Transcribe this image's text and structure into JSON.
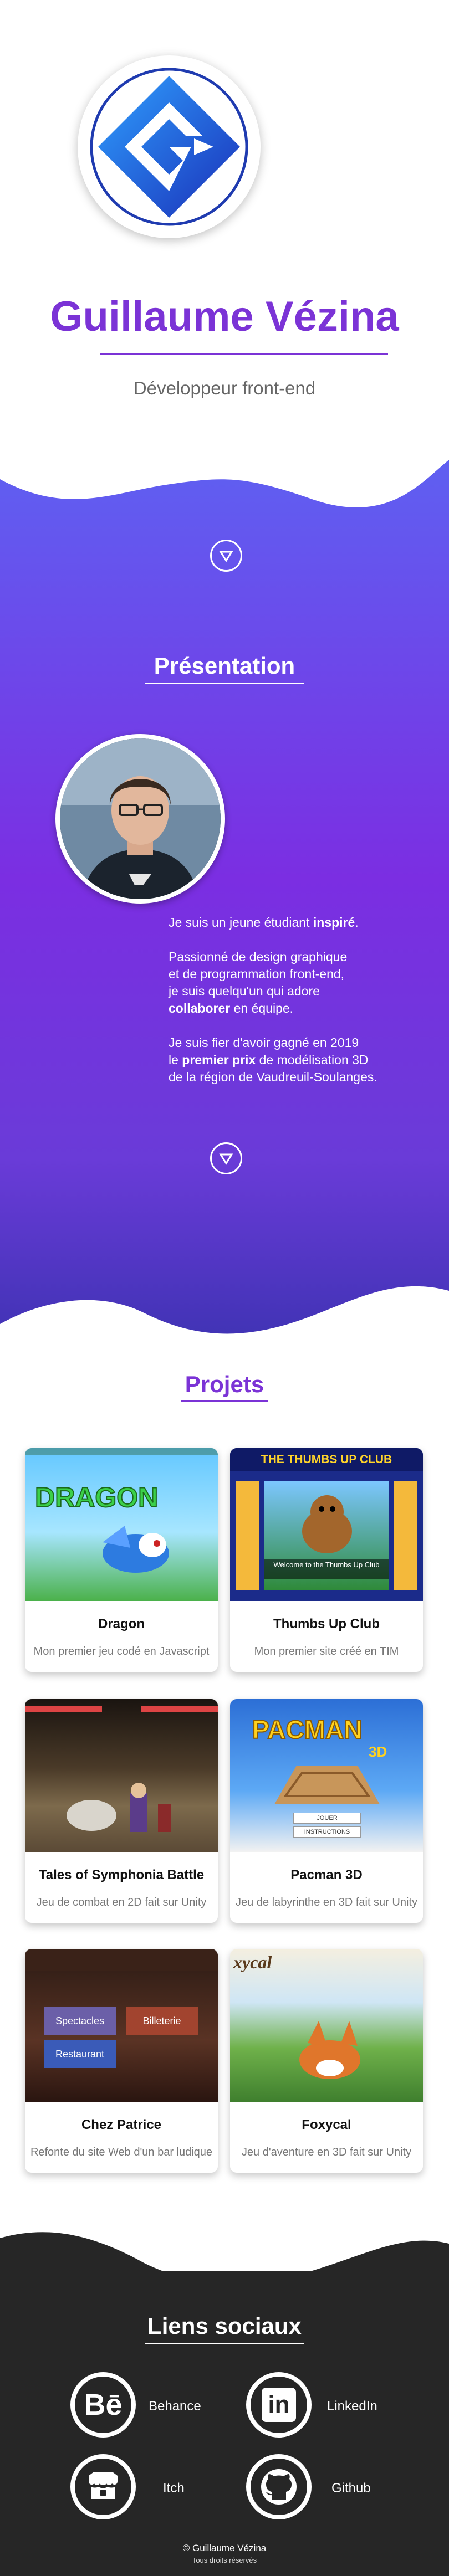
{
  "header": {
    "name": "Guillaume Vézina",
    "subtitle": "Développeur front-end"
  },
  "presentation": {
    "title": "Présentation",
    "p1_pre": "Je suis un jeune étudiant ",
    "p1_bold": "inspiré",
    "p1_post": ".",
    "p2_line1": "Passionné de design graphique",
    "p2_line2": "et de programmation front-end,",
    "p2_line3": "je suis quelqu'un qui adore",
    "p2_bold": "collaborer",
    "p2_post": " en équipe.",
    "p3_line1": "Je suis fier d'avoir gagné en 2019",
    "p3_pre": "le ",
    "p3_bold": "premier prix",
    "p3_post": " de modélisation 3D",
    "p3_line3": "de la région de Vaudreuil-Soulanges."
  },
  "projects": {
    "title": "Projets",
    "items": [
      {
        "title": "Dragon",
        "desc": "Mon premier jeu codé en Javascript"
      },
      {
        "title": "Thumbs Up Club",
        "desc": "Mon premier site créé en TIM"
      },
      {
        "title": "Tales of Symphonia Battle",
        "desc": "Jeu de combat en 2D fait sur Unity"
      },
      {
        "title": "Pacman 3D",
        "desc": "Jeu de labyrinthe en 3D fait sur Unity"
      },
      {
        "title": "Chez Patrice",
        "desc": "Refonte du site Web d'un bar ludique"
      },
      {
        "title": "Foxycal",
        "desc": "Jeu d'aventure en 3D fait sur Unity"
      }
    ],
    "thumb_text": {
      "dragon_logo": "DRAGON",
      "thumbs_header": "THE THUMBS UP CLUB",
      "thumbs_welcome": "Welcome to the Thumbs Up Club",
      "pacman_logo": "PACMAN",
      "pacman_3d": "3D",
      "pacman_btn1": "JOUER",
      "pacman_btn2": "INSTRUCTIONS",
      "patrice_btn1": "Spectacles",
      "patrice_btn2": "Billeterie",
      "patrice_btn3": "Restaurant",
      "foxycal_logo": "xycal"
    }
  },
  "social": {
    "title": "Liens sociaux",
    "behance_label": "Behance",
    "linkedin_label": "LinkedIn",
    "itch_label": "Itch",
    "github_label": "Github",
    "behance_glyph": "Bē",
    "linkedin_glyph": "in",
    "copyright": "© Guillaume Vézina",
    "rights": "Tous droits réservés"
  },
  "colors": {
    "accent": "#7b33d6",
    "gradient_top": "#5d63f2",
    "gradient_bottom": "#3b32b0",
    "footer": "#262626"
  },
  "icons": {
    "logo": "gv-logo-icon",
    "scroll": "chevron-down-circle-icon",
    "behance": "behance-icon",
    "linkedin": "linkedin-icon",
    "itch": "itch-icon",
    "github": "github-icon"
  }
}
